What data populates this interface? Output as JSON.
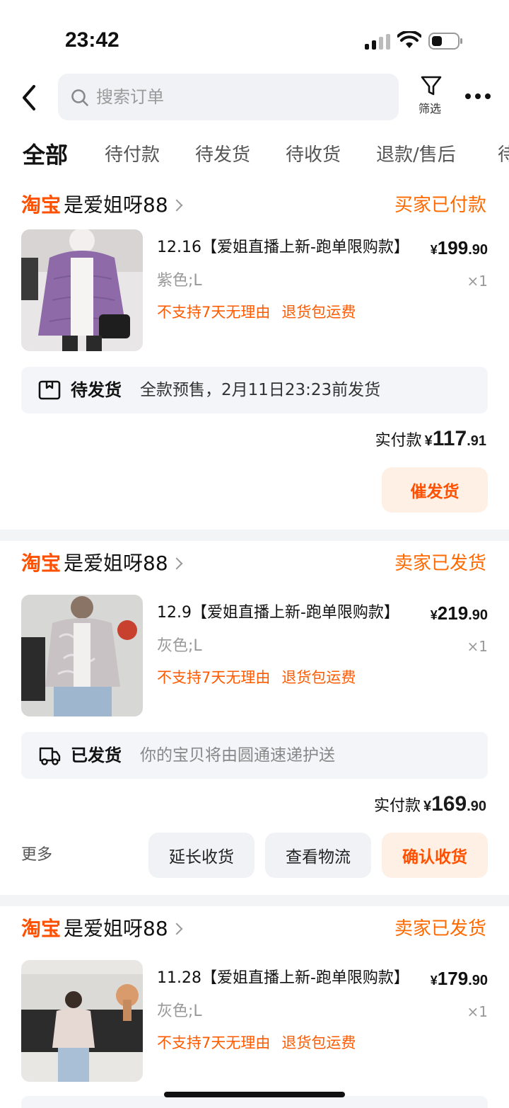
{
  "status_bar": {
    "time": "23:42"
  },
  "header": {
    "search_placeholder": "搜索订单",
    "filter_label": "筛选"
  },
  "tabs": [
    {
      "label": "全部"
    },
    {
      "label": "待付款"
    },
    {
      "label": "待发货"
    },
    {
      "label": "待收货"
    },
    {
      "label": "退款/售后"
    },
    {
      "label": "待"
    }
  ],
  "orders": [
    {
      "shop_logo": "淘宝",
      "shop_name": "是爱姐呀88",
      "status": "买家已付款",
      "title": "12.16【爱姐直播上新-跑单限购款】",
      "price_int": "199",
      "price_dec": ".90",
      "variant": "紫色;L",
      "qty": "×1",
      "tags": [
        "不支持7天无理由",
        "退货包运费"
      ],
      "logistics_state": "待发货",
      "logistics_desc": "全款预售，2月11日23:23前发货",
      "paid_label": "实付款",
      "paid_int": "117",
      "paid_dec": ".91",
      "buttons": [
        "催发货"
      ]
    },
    {
      "shop_logo": "淘宝",
      "shop_name": "是爱姐呀88",
      "status": "卖家已发货",
      "title": "12.9【爱姐直播上新-跑单限购款】",
      "price_int": "219",
      "price_dec": ".90",
      "variant": "灰色;L",
      "qty": "×1",
      "tags": [
        "不支持7天无理由",
        "退货包运费"
      ],
      "logistics_state": "已发货",
      "logistics_desc": "你的宝贝将由圆通速递护送",
      "paid_label": "实付款",
      "paid_int": "169",
      "paid_dec": ".90",
      "more_label": "更多",
      "buttons": [
        "延长收货",
        "查看物流",
        "确认收货"
      ]
    },
    {
      "shop_logo": "淘宝",
      "shop_name": "是爱姐呀88",
      "status": "卖家已发货",
      "title": "11.28【爱姐直播上新-跑单限购款】",
      "price_int": "179",
      "price_dec": ".90",
      "variant": "灰色;L",
      "qty": "×1",
      "tags": [
        "不支持7天无理由",
        "退货包运费"
      ]
    }
  ],
  "colors": {
    "accent": "#ff5000",
    "status_orange": "#ff6a00",
    "primary_btn_bg": "#fff0e6"
  }
}
